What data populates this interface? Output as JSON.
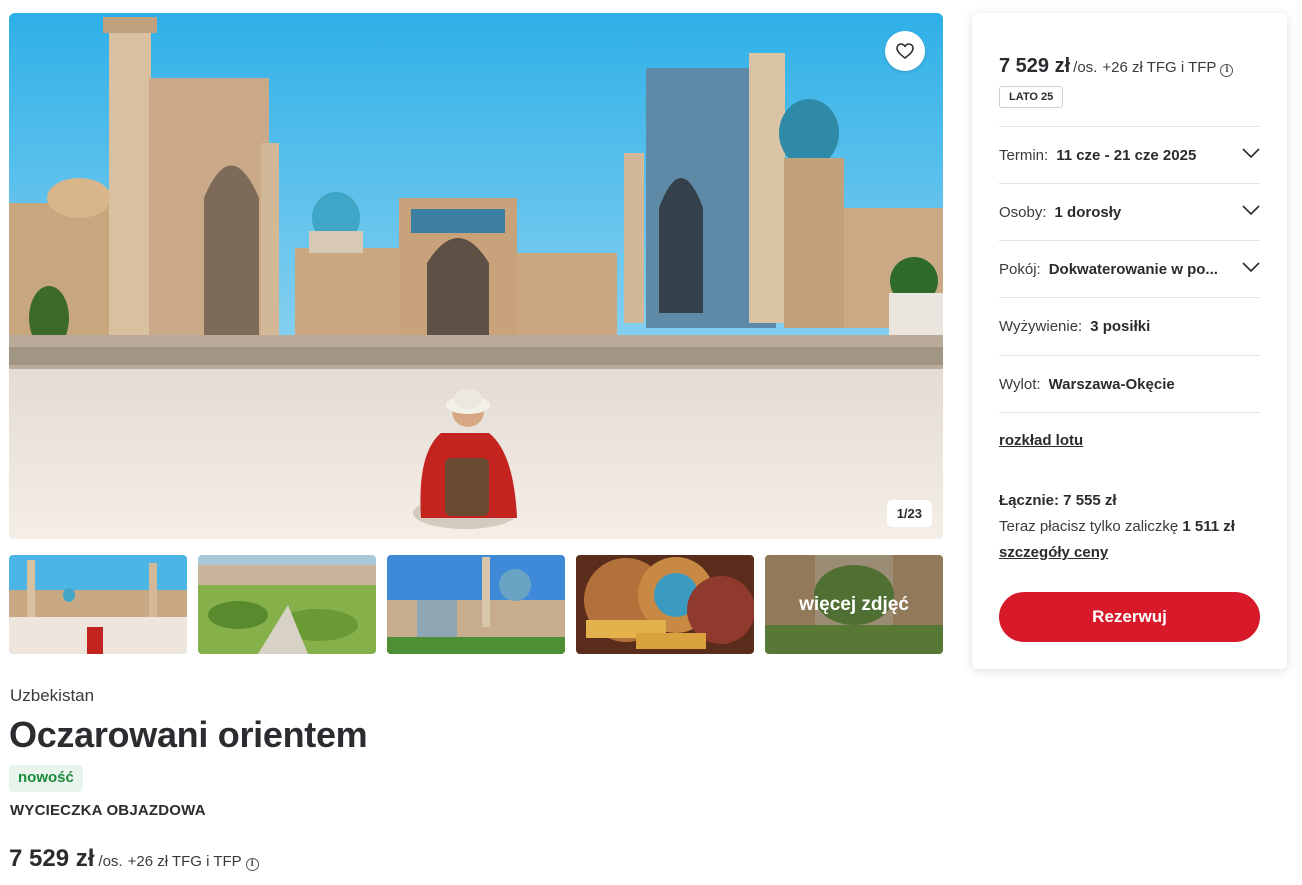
{
  "gallery": {
    "counter": "1/23",
    "more_photos_label": "więcej zdjęć"
  },
  "trip": {
    "country": "Uzbekistan",
    "title": "Oczarowani orientem",
    "badge": "nowość",
    "type": "WYCIECZKA OBJAZDOWA",
    "price": "7 529 zł",
    "per_person": "/os.",
    "fees": "+26 zł TFG i TFP"
  },
  "booking": {
    "price": "7 529 zł",
    "per_person": "/os.",
    "fees": "+26 zł TFG i TFP",
    "season_tag": "LATO 25",
    "term_label": "Termin:",
    "term_value": "11 cze - 21 cze 2025",
    "persons_label": "Osoby:",
    "persons_value": "1 dorosły",
    "room_label": "Pokój:",
    "room_value": "Dokwaterowanie w po...",
    "board_label": "Wyżywienie:",
    "board_value": "3 posiłki",
    "departure_label": "Wylot:",
    "departure_value": "Warszawa-Okęcie",
    "flight_schedule_link": "rozkład lotu",
    "total": "Łącznie: 7 555 zł",
    "deposit_text": "Teraz płacisz tylko zaliczkę",
    "deposit_amount": "1 511 zł",
    "price_details_link": "szczegóły ceny",
    "reserve_button": "Rezerwuj"
  },
  "colors": {
    "accent": "#d7192a",
    "new_badge_bg": "#e9f5ec",
    "new_badge_text": "#1b8a3c"
  },
  "icons": [
    "heart-icon",
    "info-icon",
    "chevron-down-icon"
  ]
}
